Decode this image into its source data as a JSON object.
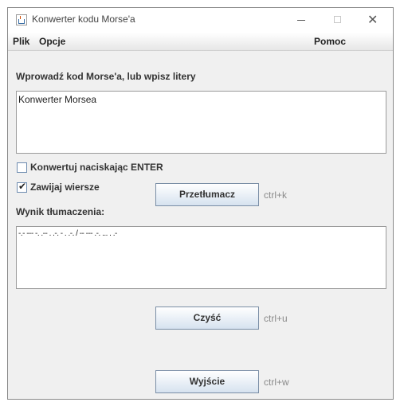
{
  "window": {
    "title": "Konwerter kodu Morse'a"
  },
  "menu": {
    "file": "Plik",
    "options": "Opcje",
    "help": "Pomoc"
  },
  "input_section": {
    "label": "Wprowadź kod Morse'a, lub wpisz litery",
    "text": "Konwerter Morsea"
  },
  "options": {
    "convert_on_enter": {
      "label": "Konwertuj naciskając ENTER",
      "checked": false
    },
    "wrap_lines": {
      "label": "Zawijaj wiersze",
      "checked": true
    }
  },
  "output_section": {
    "label": "Wynik tłumaczenia:",
    "text": "-.- --- -. .-- . .-. - . .-. / -- --- .-. ... . .-"
  },
  "buttons": {
    "translate": {
      "label": "Przetłumacz",
      "shortcut": "ctrl+k"
    },
    "clear": {
      "label": "Czyść",
      "shortcut": "ctrl+u"
    },
    "exit": {
      "label": "Wyjście",
      "shortcut": "ctrl+w"
    }
  },
  "icons": {
    "app": "java-cup-icon",
    "minimize": "minimize-icon",
    "maximize": "maximize-icon",
    "close": "close-icon"
  }
}
